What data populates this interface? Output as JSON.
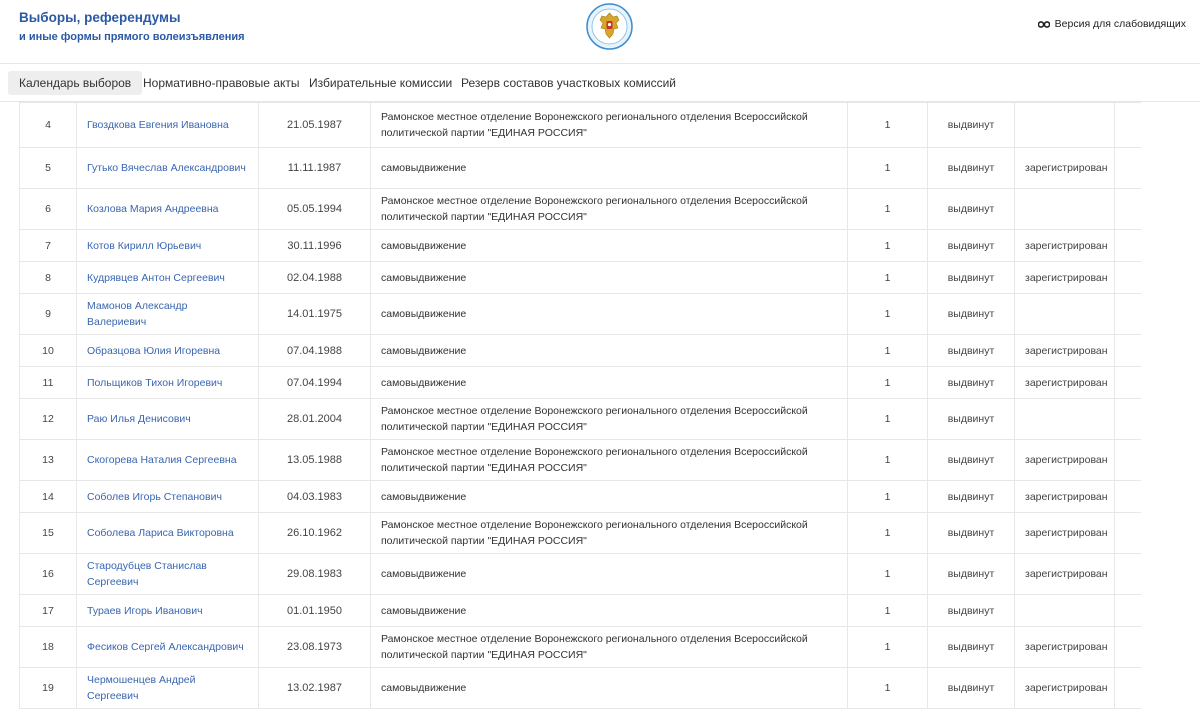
{
  "header": {
    "title": "Выборы, референдумы",
    "subtitle": "и иные формы прямого волеизъявления",
    "accessibility_label": "Версия для слабовидящих",
    "brand_color": "#2b59a5"
  },
  "nav": {
    "items": [
      {
        "label": "Календарь выборов",
        "active": true
      },
      {
        "label": "Нормативно-правовые акты",
        "active": false
      },
      {
        "label": "Избирательные комиссии",
        "active": false
      },
      {
        "label": "Резерв составов участковых комиссий",
        "active": false
      }
    ]
  },
  "table": {
    "rows": [
      {
        "num": "4",
        "name": "Гвоздкова Евгения Ивановна",
        "date": "21.05.1987",
        "party": "Рамонское местное отделение Воронежского регионального отделения Всероссийской политической партии \"ЕДИНАЯ РОССИЯ\"",
        "count": "1",
        "status": "выдвинут",
        "reg": ""
      },
      {
        "num": "5",
        "name": "Гутько Вячеслав Александрович",
        "date": "11.11.1987",
        "party": "самовыдвижение",
        "count": "1",
        "status": "выдвинут",
        "reg": "зарегистрирован"
      },
      {
        "num": "6",
        "name": "Козлова Мария Андреевна",
        "date": "05.05.1994",
        "party": "Рамонское местное отделение Воронежского регионального отделения Всероссийской политической партии \"ЕДИНАЯ РОССИЯ\"",
        "count": "1",
        "status": "выдвинут",
        "reg": ""
      },
      {
        "num": "7",
        "name": "Котов Кирилл Юрьевич",
        "date": "30.11.1996",
        "party": "самовыдвижение",
        "count": "1",
        "status": "выдвинут",
        "reg": "зарегистрирован"
      },
      {
        "num": "8",
        "name": "Кудрявцев Антон Сергеевич",
        "date": "02.04.1988",
        "party": "самовыдвижение",
        "count": "1",
        "status": "выдвинут",
        "reg": "зарегистрирован"
      },
      {
        "num": "9",
        "name": "Мамонов Александр Валериевич",
        "date": "14.01.1975",
        "party": "самовыдвижение",
        "count": "1",
        "status": "выдвинут",
        "reg": ""
      },
      {
        "num": "10",
        "name": "Образцова Юлия Игоревна",
        "date": "07.04.1988",
        "party": "самовыдвижение",
        "count": "1",
        "status": "выдвинут",
        "reg": "зарегистрирован"
      },
      {
        "num": "11",
        "name": "Польщиков Тихон Игоревич",
        "date": "07.04.1994",
        "party": "самовыдвижение",
        "count": "1",
        "status": "выдвинут",
        "reg": "зарегистрирован"
      },
      {
        "num": "12",
        "name": "Раю Илья Денисович",
        "date": "28.01.2004",
        "party": "Рамонское местное отделение Воронежского регионального отделения Всероссийской политической партии \"ЕДИНАЯ РОССИЯ\"",
        "count": "1",
        "status": "выдвинут",
        "reg": ""
      },
      {
        "num": "13",
        "name": "Скогорева Наталия Сергеевна",
        "date": "13.05.1988",
        "party": "Рамонское местное отделение Воронежского регионального отделения Всероссийской политической партии \"ЕДИНАЯ РОССИЯ\"",
        "count": "1",
        "status": "выдвинут",
        "reg": "зарегистрирован"
      },
      {
        "num": "14",
        "name": "Соболев Игорь Степанович",
        "date": "04.03.1983",
        "party": "самовыдвижение",
        "count": "1",
        "status": "выдвинут",
        "reg": "зарегистрирован"
      },
      {
        "num": "15",
        "name": "Соболева Лариса Викторовна",
        "date": "26.10.1962",
        "party": "Рамонское местное отделение Воронежского регионального отделения Всероссийской политической партии \"ЕДИНАЯ РОССИЯ\"",
        "count": "1",
        "status": "выдвинут",
        "reg": "зарегистрирован"
      },
      {
        "num": "16",
        "name": "Стародубцев Станислав Сергеевич",
        "date": "29.08.1983",
        "party": "самовыдвижение",
        "count": "1",
        "status": "выдвинут",
        "reg": "зарегистрирован"
      },
      {
        "num": "17",
        "name": "Тураев Игорь Иванович",
        "date": "01.01.1950",
        "party": "самовыдвижение",
        "count": "1",
        "status": "выдвинут",
        "reg": ""
      },
      {
        "num": "18",
        "name": "Фесиков Сергей Александрович",
        "date": "23.08.1973",
        "party": "Рамонское местное отделение Воронежского регионального отделения Всероссийской политической партии \"ЕДИНАЯ РОССИЯ\"",
        "count": "1",
        "status": "выдвинут",
        "reg": "зарегистрирован"
      },
      {
        "num": "19",
        "name": "Чермошенцев Андрей Сергеевич",
        "date": "13.02.1987",
        "party": "самовыдвижение",
        "count": "1",
        "status": "выдвинут",
        "reg": "зарегистрирован"
      }
    ]
  }
}
